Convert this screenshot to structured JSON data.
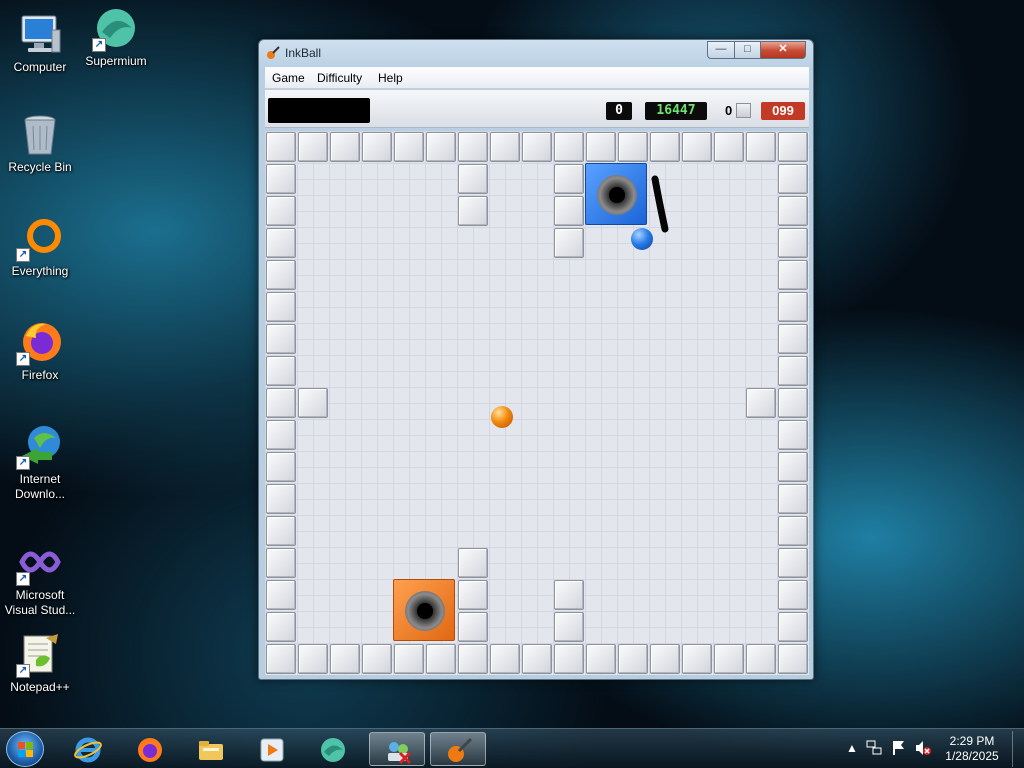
{
  "desktop": {
    "icons": [
      {
        "label": "Computer",
        "icon": "computer-icon"
      },
      {
        "label": "Supermium",
        "icon": "supermium-icon"
      },
      {
        "label": "Recycle Bin",
        "icon": "recycle-bin-icon"
      },
      {
        "label": "Everything",
        "icon": "everything-icon"
      },
      {
        "label": "Firefox",
        "icon": "firefox-icon"
      },
      {
        "label": "Internet Downlo...",
        "icon": "internet-download-manager-icon"
      },
      {
        "label": "Microsoft Visual Stud...",
        "icon": "visual-studio-icon"
      },
      {
        "label": "Notepad++",
        "icon": "notepad-plus-plus-icon"
      }
    ]
  },
  "window": {
    "title": "InkBall",
    "controls": {
      "minimize": "—",
      "maximize": "□",
      "close": "✕"
    }
  },
  "menu": {
    "items": [
      {
        "label": "Game"
      },
      {
        "label": "Difficulty"
      },
      {
        "label": "Help"
      }
    ]
  },
  "scorebar": {
    "score": "0",
    "high_score": "16447",
    "lost_count": "0",
    "timer": "099"
  },
  "colors": {
    "blue_hole": "#1a64d8",
    "orange_hole": "#e06812",
    "timer_bg": "#c23a26",
    "high_score_text": "#6fe36f"
  },
  "taskbar": {
    "pinned": [
      {
        "icon": "internet-explorer-icon"
      },
      {
        "icon": "firefox-icon"
      },
      {
        "icon": "file-explorer-icon"
      },
      {
        "icon": "media-player-icon"
      },
      {
        "icon": "supermium-icon"
      },
      {
        "icon": "network-app-icon"
      },
      {
        "icon": "inkball-icon"
      }
    ],
    "clock": {
      "time": "2:29 PM",
      "date": "1/28/2025"
    }
  }
}
